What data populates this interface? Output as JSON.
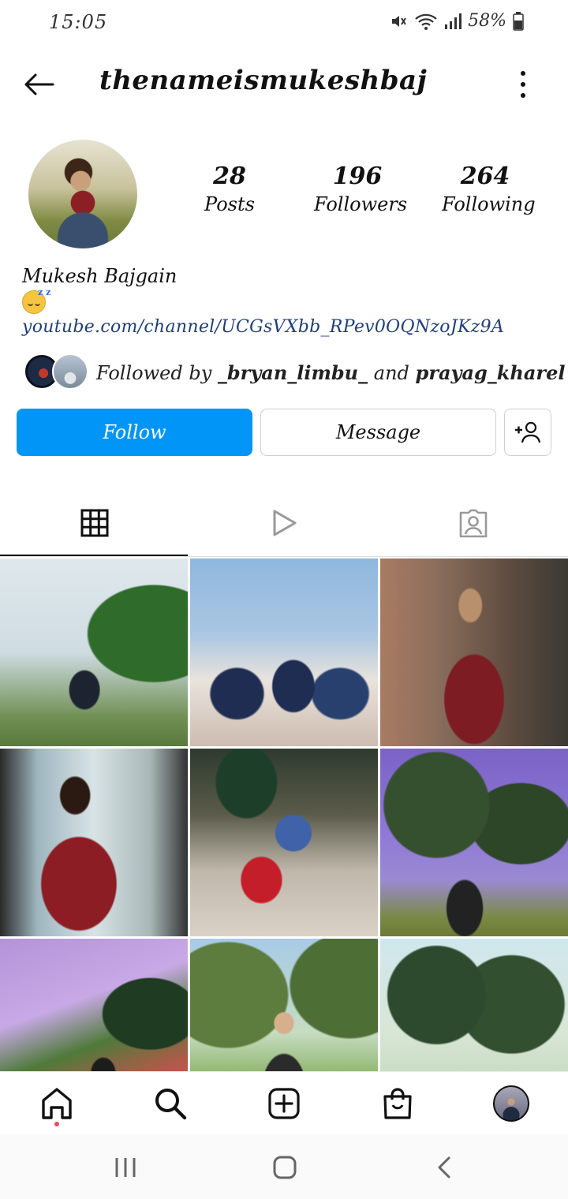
{
  "status_bar": {
    "time": "15:05",
    "battery": "58%",
    "icons": [
      "mute-icon",
      "wifi-icon",
      "signal-icon",
      "battery-icon"
    ]
  },
  "header": {
    "username": "thenameismukeshbaj",
    "icons": [
      "back-arrow-icon",
      "more-vertical-icon"
    ]
  },
  "profile": {
    "stats": {
      "posts": {
        "value": "28",
        "label": "Posts"
      },
      "followers": {
        "value": "196",
        "label": "Followers"
      },
      "following": {
        "value": "264",
        "label": "Following"
      }
    },
    "full_name": "Mukesh Bajgain",
    "bio_emoji": "sleeping-face-emoji",
    "link": "youtube.com/channel/UCGsVXbb_RPev0OQNzoJKz9A",
    "followed_by": {
      "prefix": "Followed by",
      "user1": "_bryan_limbu_",
      "conjunction": "and",
      "user2": "prayag_kharel"
    }
  },
  "actions": {
    "follow_label": "Follow",
    "message_label": "Message",
    "add_user_icon": "add-user-icon",
    "follow_color": "#0095f6"
  },
  "tabs": [
    {
      "name": "posts-grid",
      "icon": "grid-icon",
      "active": true
    },
    {
      "name": "reels",
      "icon": "play-icon",
      "active": false
    },
    {
      "name": "tagged",
      "icon": "tagged-person-icon",
      "active": false
    }
  ],
  "posts_count_visible": 9,
  "bottom_nav": [
    {
      "name": "home",
      "icon": "home-icon",
      "notification_dot": true
    },
    {
      "name": "search",
      "icon": "search-icon"
    },
    {
      "name": "create",
      "icon": "plus-square-icon"
    },
    {
      "name": "shop",
      "icon": "shopping-bag-icon"
    },
    {
      "name": "profile",
      "icon": "avatar"
    }
  ],
  "system_nav": [
    "recent-apps-icon",
    "home-circle-icon",
    "back-chevron-icon"
  ]
}
